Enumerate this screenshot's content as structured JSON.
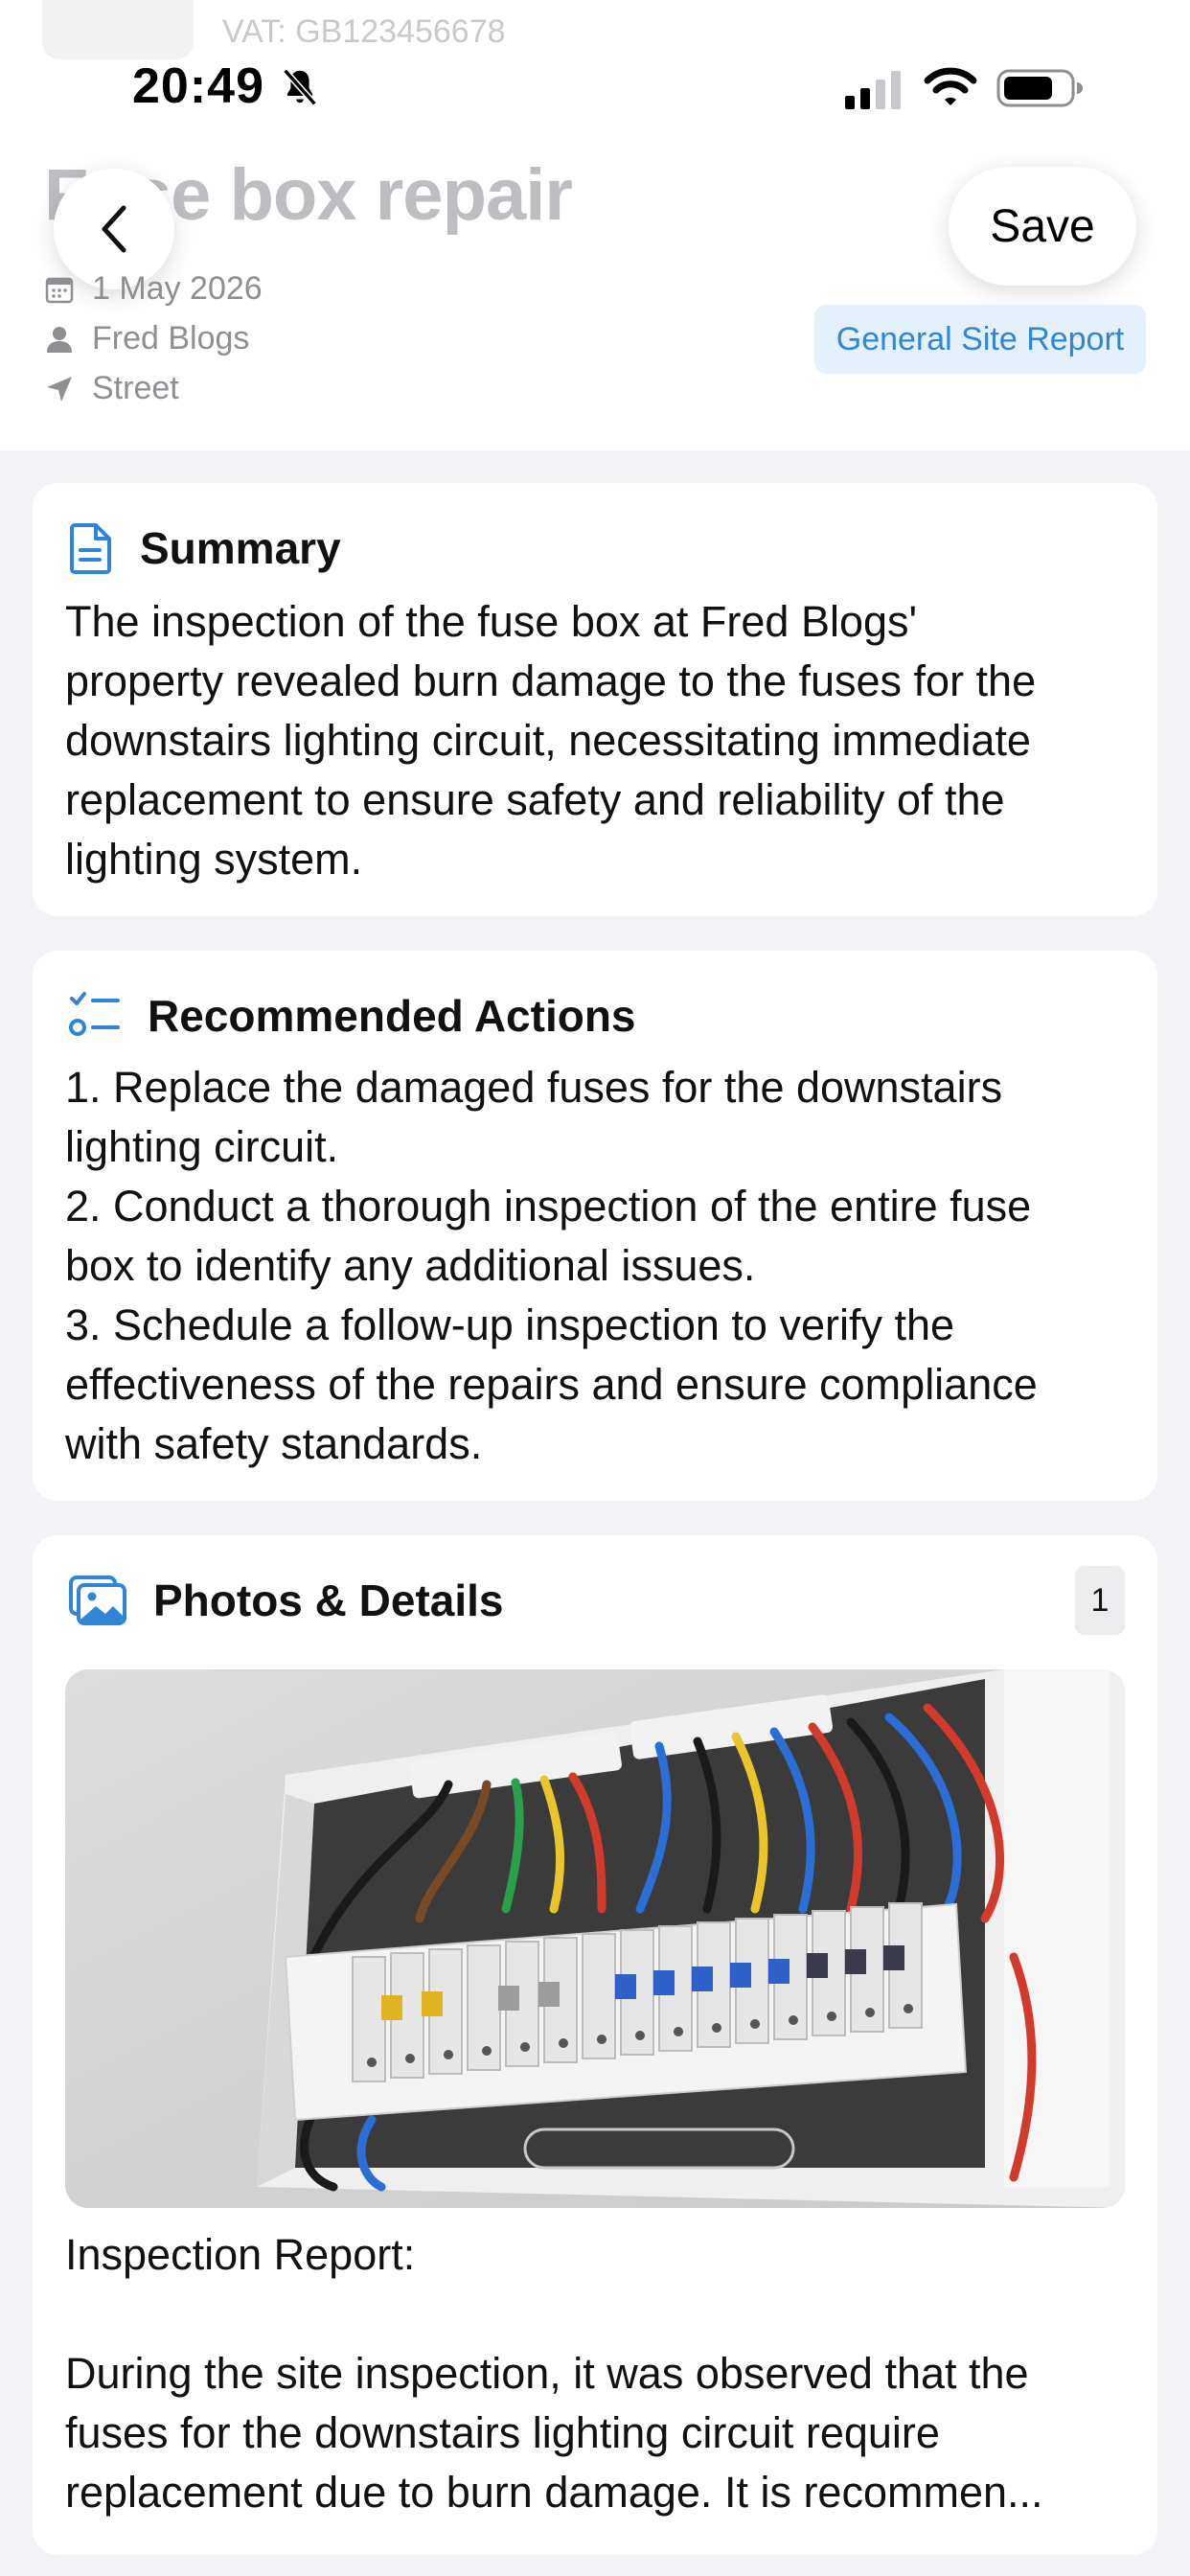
{
  "ghost_header": {
    "subtitle": "VAT: GB123456678"
  },
  "status_bar": {
    "time": "20:49"
  },
  "report": {
    "title": "Fuse box repair",
    "date": "1 May 2026",
    "client": "Fred Blogs",
    "location": "Street",
    "type_badge": "General Site Report"
  },
  "nav": {
    "save_label": "Save"
  },
  "summary": {
    "heading": "Summary",
    "text": "The inspection of the fuse box at Fred Blogs'\nproperty revealed burn damage to the fuses for the\ndownstairs lighting circuit, necessitating immediate\nreplacement to ensure safety and reliability of the\nlighting system."
  },
  "actions": {
    "heading": "Recommended Actions",
    "text": "1. Replace the damaged fuses for the downstairs\nlighting circuit.\n2. Conduct a thorough inspection of the entire fuse\nbox to identify any additional issues.\n3. Schedule a follow-up inspection to verify the\neffectiveness of the repairs and ensure compliance\nwith safety standards."
  },
  "photos": {
    "heading": "Photos & Details",
    "count": "1",
    "caption": "Inspection Report:\n\nDuring the site inspection, it was observed that the\nfuses for the downstairs lighting circuit require\nreplacement due to burn damage. It is recommen..."
  },
  "icons": {
    "back": "chevron-left-icon",
    "calendar": "calendar-icon",
    "user": "person-icon",
    "location": "location-arrow-icon",
    "summary": "document-icon",
    "actions": "checklist-icon",
    "photos": "photos-icon",
    "bell": "bell-slash-icon"
  },
  "colors": {
    "accent": "#2f86d6",
    "badge_bg": "#e4f1fd",
    "background": "#f2f2f7"
  }
}
